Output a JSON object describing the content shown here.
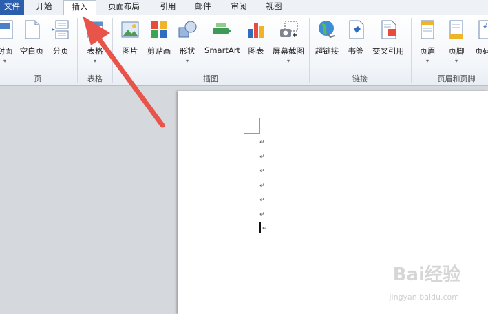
{
  "tabs": [
    {
      "label": "文件"
    },
    {
      "label": "开始"
    },
    {
      "label": "插入"
    },
    {
      "label": "页面布局"
    },
    {
      "label": "引用"
    },
    {
      "label": "邮件"
    },
    {
      "label": "审阅"
    },
    {
      "label": "视图"
    }
  ],
  "ribbon": {
    "groups": [
      {
        "label": "页"
      },
      {
        "label": "表格"
      },
      {
        "label": "插图"
      },
      {
        "label": "链接"
      },
      {
        "label": "页眉和页脚"
      }
    ],
    "buttons": {
      "cover": "封面",
      "blank": "空白页",
      "pagebreak": "分页",
      "table": "表格",
      "picture": "图片",
      "clipart": "剪贴画",
      "shapes": "形状",
      "smartart": "SmartArt",
      "chart": "图表",
      "screenshot": "屏幕截图",
      "hyperlink": "超链接",
      "bookmark": "书签",
      "crossref": "交叉引用",
      "header": "页眉",
      "footer": "页脚",
      "pagenum": "页码"
    }
  },
  "document": {
    "paragraph_mark": "↵"
  },
  "watermark": {
    "brand": "Bai经验",
    "url": "jingyan.baidu.com"
  },
  "colors": {
    "file_tab": "#2b5fad",
    "arrow": "#e8544a"
  }
}
